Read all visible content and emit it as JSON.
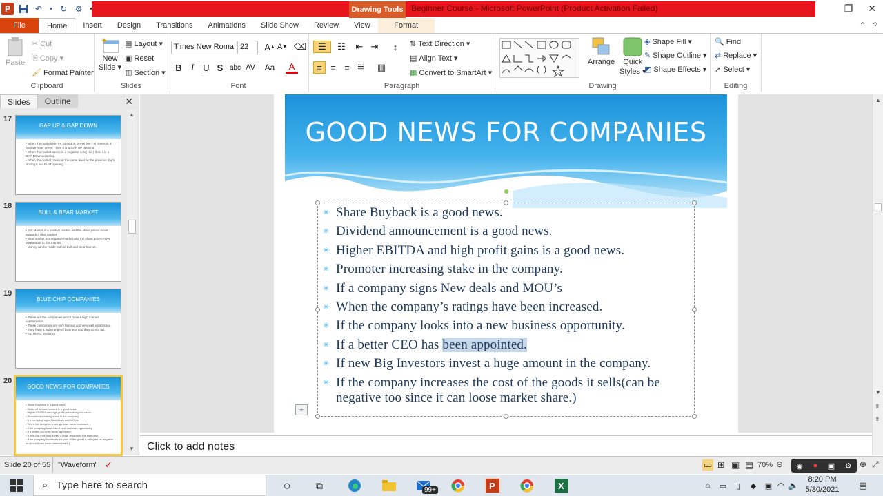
{
  "titlebar": {
    "drawing_tools": "Drawing Tools",
    "window_title": "Beginner Course - Microsoft PowerPoint (Product Activation Failed)",
    "ppt_logo": "P"
  },
  "tabs": [
    "File",
    "Home",
    "Insert",
    "Design",
    "Transitions",
    "Animations",
    "Slide Show",
    "Review",
    "View",
    "Format"
  ],
  "ribbon": {
    "clipboard": {
      "label": "Clipboard",
      "paste": "Paste",
      "cut": "Cut",
      "copy": "Copy",
      "format_painter": "Format Painter"
    },
    "slides": {
      "label": "Slides",
      "new_slide": "New",
      "new_slide2": "Slide",
      "layout": "Layout",
      "reset": "Reset",
      "section": "Section"
    },
    "font": {
      "label": "Font",
      "font_name": "Times New Roma",
      "font_size": "22"
    },
    "paragraph": {
      "label": "Paragraph",
      "text_direction": "Text Direction",
      "align_text": "Align Text",
      "convert_smartart": "Convert to SmartArt"
    },
    "drawing": {
      "label": "Drawing",
      "arrange": "Arrange",
      "quick": "Quick",
      "styles": "Styles",
      "shape_fill": "Shape Fill",
      "shape_outline": "Shape Outline",
      "shape_effects": "Shape Effects"
    },
    "editing": {
      "label": "Editing",
      "find": "Find",
      "replace": "Replace",
      "select": "Select"
    }
  },
  "left_pane": {
    "tab_slides": "Slides",
    "tab_outline": "Outline",
    "thumbnails": [
      {
        "num": "17",
        "title": "GAP UP & GAP DOWN",
        "lines": [
          "When the market(NIFTY, SENSEX, BANK NIFTY) opens in a positive note( green ) then it is a GAP UP opening",
          "When the market opens in a negative note( red ) then it is a GAP DOWN opening.",
          "When the market opens at the same level as the previous day's closing it is a FLAT opening"
        ]
      },
      {
        "num": "18",
        "title": "BULL & BEAR MARKET",
        "lines": [
          "Bull Market is a positive market and the share prices move upwards in this market.",
          "Bear market is a negative market and the share prices move downwards in this market.",
          "Money can be made both in Bull and Bear Market."
        ]
      },
      {
        "num": "19",
        "title": "BLUE CHIP COMPANIES",
        "lines": [
          "These are the companies which have a high market capitalization.",
          "These companies are very famous and very well established.",
          "They have a wide range of business and they do not fail.",
          "Eg: HDFC, Reliance"
        ]
      },
      {
        "num": "20",
        "title": "GOOD NEWS FOR COMPANIES",
        "lines": [
          "Share Buyback is a good news.",
          "Dividend announcement is a good news.",
          "Higher EBITDA and high profit gains is a good news.",
          "Promoter increasing stake in the company.",
          "If a company signs New deals and MOU's",
          "When the company's ratings have been increased.",
          "If the company looks into a new business opportunity.",
          "If a better CEO has been appointed.",
          "If new Big Investors invest a huge amount in the company.",
          "If the company increases the cost of the goods it sells(can be negative too since it can loose market share.)"
        ]
      }
    ]
  },
  "slide": {
    "title": "GOOD NEWS FOR COMPANIES",
    "bullets": [
      "Share Buyback is a good news.",
      "Dividend announcement is a good news.",
      "Higher EBITDA and high profit gains is a good news.",
      "Promoter increasing stake in the company.",
      "If a company signs New deals and MOU’s",
      "When the company’s ratings have been increased.",
      "If the company looks into a new business opportunity."
    ],
    "bullet8_pre": "If a better CEO has",
    "bullet8_hl": "been appointed.",
    "bullet9": "If new Big Investors invest a huge amount in the company.",
    "bullet10": "If the company increases the cost of the goods it sells(can be negative too since it can loose market share.)"
  },
  "notes": {
    "placeholder": "Click to add notes"
  },
  "status": {
    "slide_info": "Slide 20 of 55",
    "theme": "\"Waveform\"",
    "zoom": "70%"
  },
  "taskbar": {
    "search_placeholder": "Type here to search",
    "time": "8:20 PM",
    "date": "5/30/2021",
    "mail_badge": "99+"
  },
  "colors": {
    "accent": "#d8440b",
    "title_band": "#e8141c",
    "slide_blue": "#1893d9"
  }
}
